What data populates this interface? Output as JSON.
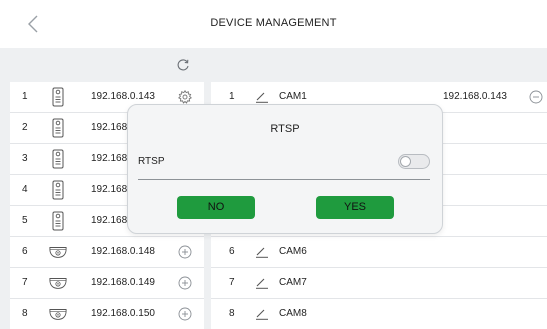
{
  "header": {
    "title": "DEVICE MANAGEMENT"
  },
  "left_rows": [
    {
      "index": "1",
      "ip": "192.168.0.143",
      "type": "intercom",
      "action": "gear-icon"
    },
    {
      "index": "2",
      "ip": "192.168.",
      "type": "intercom",
      "action": ""
    },
    {
      "index": "3",
      "ip": "192.168.",
      "type": "intercom",
      "action": ""
    },
    {
      "index": "4",
      "ip": "192.168.",
      "type": "intercom",
      "action": ""
    },
    {
      "index": "5",
      "ip": "192.168.",
      "type": "intercom",
      "action": ""
    },
    {
      "index": "6",
      "ip": "192.168.0.148",
      "type": "camera",
      "action": "add-icon"
    },
    {
      "index": "7",
      "ip": "192.168.0.149",
      "type": "camera",
      "action": "add-icon"
    },
    {
      "index": "8",
      "ip": "192.168.0.150",
      "type": "camera",
      "action": "add-icon"
    }
  ],
  "right_rows": [
    {
      "index": "1",
      "name": "CAM1",
      "ip": "192.168.0.143",
      "action": "remove-icon"
    },
    {
      "index": "",
      "name": "",
      "ip": "",
      "action": ""
    },
    {
      "index": "",
      "name": "",
      "ip": "",
      "action": ""
    },
    {
      "index": "",
      "name": "",
      "ip": "",
      "action": ""
    },
    {
      "index": "",
      "name": "",
      "ip": "",
      "action": ""
    },
    {
      "index": "6",
      "name": "CAM6",
      "ip": "",
      "action": ""
    },
    {
      "index": "7",
      "name": "CAM7",
      "ip": "",
      "action": ""
    },
    {
      "index": "8",
      "name": "CAM8",
      "ip": "",
      "action": ""
    }
  ],
  "modal": {
    "title": "RTSP",
    "label": "RTSP",
    "toggle_on": false,
    "no_label": "NO",
    "yes_label": "YES"
  },
  "colors": {
    "button_green": "#1f9b3e",
    "background": "#eef0f2"
  }
}
